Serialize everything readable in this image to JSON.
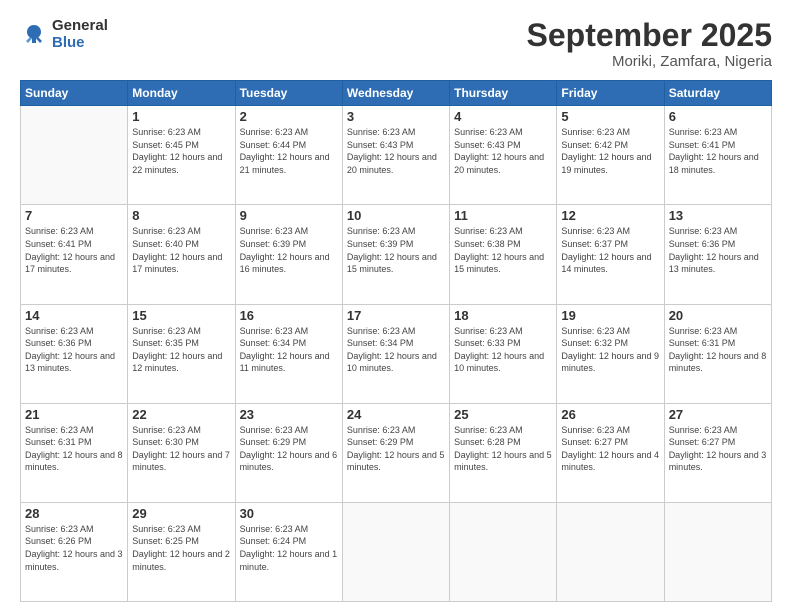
{
  "logo": {
    "general": "General",
    "blue": "Blue"
  },
  "header": {
    "title": "September 2025",
    "subtitle": "Moriki, Zamfara, Nigeria"
  },
  "weekdays": [
    "Sunday",
    "Monday",
    "Tuesday",
    "Wednesday",
    "Thursday",
    "Friday",
    "Saturday"
  ],
  "weeks": [
    [
      {
        "day": "",
        "empty": true
      },
      {
        "day": "1",
        "sunrise": "6:23 AM",
        "sunset": "6:45 PM",
        "daylight": "12 hours and 22 minutes."
      },
      {
        "day": "2",
        "sunrise": "6:23 AM",
        "sunset": "6:44 PM",
        "daylight": "12 hours and 21 minutes."
      },
      {
        "day": "3",
        "sunrise": "6:23 AM",
        "sunset": "6:43 PM",
        "daylight": "12 hours and 20 minutes."
      },
      {
        "day": "4",
        "sunrise": "6:23 AM",
        "sunset": "6:43 PM",
        "daylight": "12 hours and 20 minutes."
      },
      {
        "day": "5",
        "sunrise": "6:23 AM",
        "sunset": "6:42 PM",
        "daylight": "12 hours and 19 minutes."
      },
      {
        "day": "6",
        "sunrise": "6:23 AM",
        "sunset": "6:41 PM",
        "daylight": "12 hours and 18 minutes."
      }
    ],
    [
      {
        "day": "7",
        "sunrise": "6:23 AM",
        "sunset": "6:41 PM",
        "daylight": "12 hours and 17 minutes."
      },
      {
        "day": "8",
        "sunrise": "6:23 AM",
        "sunset": "6:40 PM",
        "daylight": "12 hours and 17 minutes."
      },
      {
        "day": "9",
        "sunrise": "6:23 AM",
        "sunset": "6:39 PM",
        "daylight": "12 hours and 16 minutes."
      },
      {
        "day": "10",
        "sunrise": "6:23 AM",
        "sunset": "6:39 PM",
        "daylight": "12 hours and 15 minutes."
      },
      {
        "day": "11",
        "sunrise": "6:23 AM",
        "sunset": "6:38 PM",
        "daylight": "12 hours and 15 minutes."
      },
      {
        "day": "12",
        "sunrise": "6:23 AM",
        "sunset": "6:37 PM",
        "daylight": "12 hours and 14 minutes."
      },
      {
        "day": "13",
        "sunrise": "6:23 AM",
        "sunset": "6:36 PM",
        "daylight": "12 hours and 13 minutes."
      }
    ],
    [
      {
        "day": "14",
        "sunrise": "6:23 AM",
        "sunset": "6:36 PM",
        "daylight": "12 hours and 13 minutes."
      },
      {
        "day": "15",
        "sunrise": "6:23 AM",
        "sunset": "6:35 PM",
        "daylight": "12 hours and 12 minutes."
      },
      {
        "day": "16",
        "sunrise": "6:23 AM",
        "sunset": "6:34 PM",
        "daylight": "12 hours and 11 minutes."
      },
      {
        "day": "17",
        "sunrise": "6:23 AM",
        "sunset": "6:34 PM",
        "daylight": "12 hours and 10 minutes."
      },
      {
        "day": "18",
        "sunrise": "6:23 AM",
        "sunset": "6:33 PM",
        "daylight": "12 hours and 10 minutes."
      },
      {
        "day": "19",
        "sunrise": "6:23 AM",
        "sunset": "6:32 PM",
        "daylight": "12 hours and 9 minutes."
      },
      {
        "day": "20",
        "sunrise": "6:23 AM",
        "sunset": "6:31 PM",
        "daylight": "12 hours and 8 minutes."
      }
    ],
    [
      {
        "day": "21",
        "sunrise": "6:23 AM",
        "sunset": "6:31 PM",
        "daylight": "12 hours and 8 minutes."
      },
      {
        "day": "22",
        "sunrise": "6:23 AM",
        "sunset": "6:30 PM",
        "daylight": "12 hours and 7 minutes."
      },
      {
        "day": "23",
        "sunrise": "6:23 AM",
        "sunset": "6:29 PM",
        "daylight": "12 hours and 6 minutes."
      },
      {
        "day": "24",
        "sunrise": "6:23 AM",
        "sunset": "6:29 PM",
        "daylight": "12 hours and 5 minutes."
      },
      {
        "day": "25",
        "sunrise": "6:23 AM",
        "sunset": "6:28 PM",
        "daylight": "12 hours and 5 minutes."
      },
      {
        "day": "26",
        "sunrise": "6:23 AM",
        "sunset": "6:27 PM",
        "daylight": "12 hours and 4 minutes."
      },
      {
        "day": "27",
        "sunrise": "6:23 AM",
        "sunset": "6:27 PM",
        "daylight": "12 hours and 3 minutes."
      }
    ],
    [
      {
        "day": "28",
        "sunrise": "6:23 AM",
        "sunset": "6:26 PM",
        "daylight": "12 hours and 3 minutes."
      },
      {
        "day": "29",
        "sunrise": "6:23 AM",
        "sunset": "6:25 PM",
        "daylight": "12 hours and 2 minutes."
      },
      {
        "day": "30",
        "sunrise": "6:23 AM",
        "sunset": "6:24 PM",
        "daylight": "12 hours and 1 minute."
      },
      {
        "day": "",
        "empty": true
      },
      {
        "day": "",
        "empty": true
      },
      {
        "day": "",
        "empty": true
      },
      {
        "day": "",
        "empty": true
      }
    ]
  ]
}
